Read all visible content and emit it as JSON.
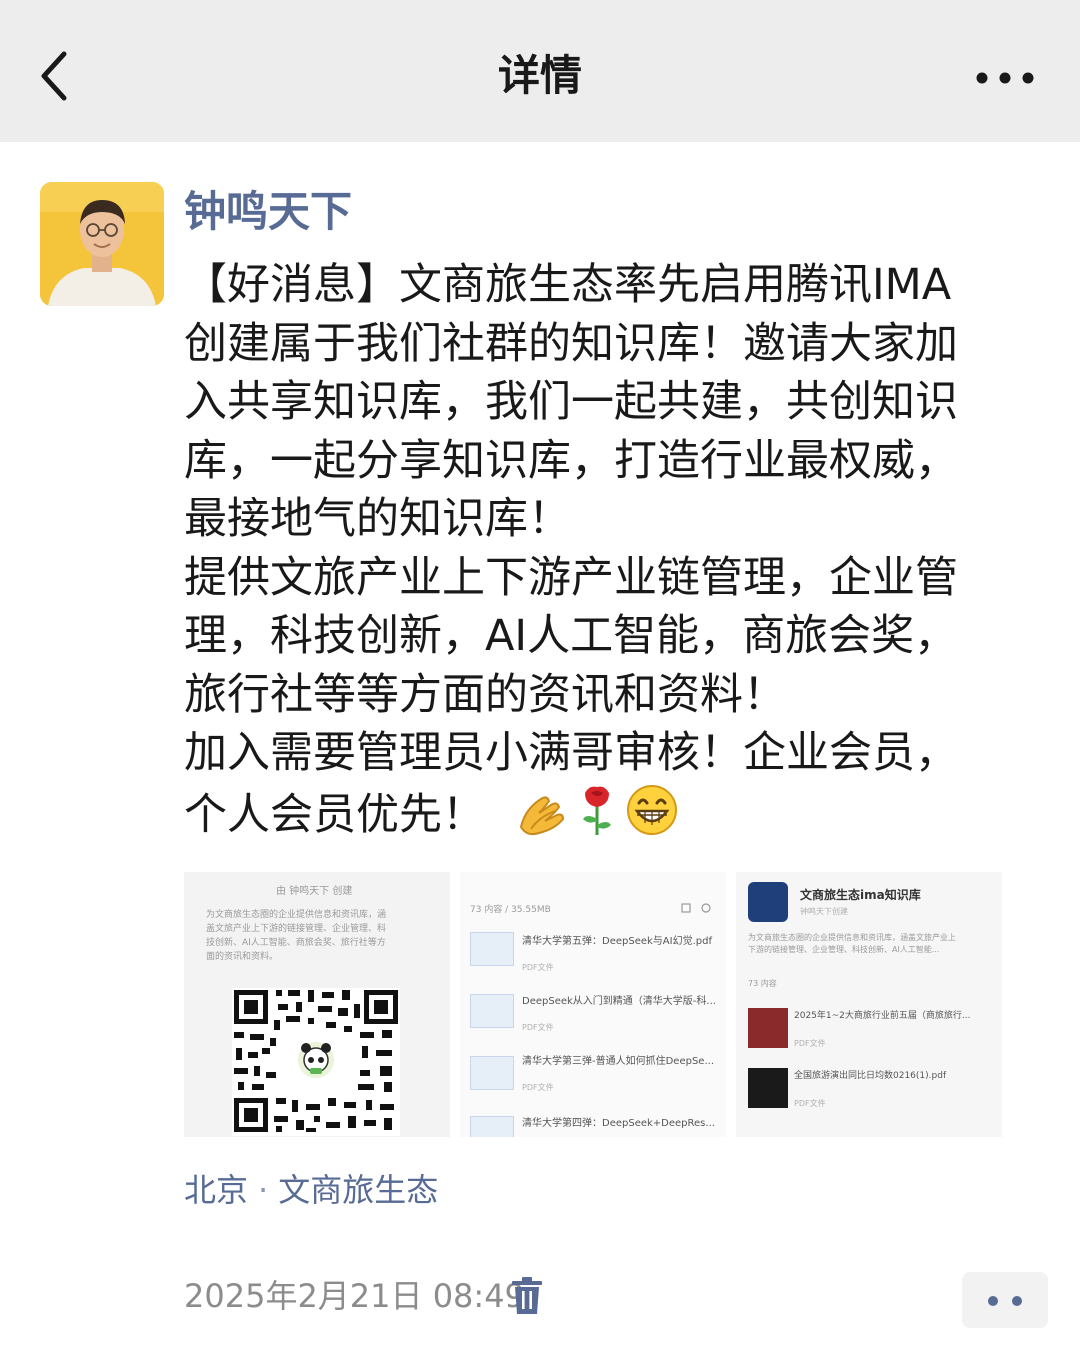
{
  "nav": {
    "title": "详情",
    "back_icon": "chevron-left-icon",
    "more_icon": "more-horizontal-icon"
  },
  "post": {
    "author": "钟鸣天下",
    "text_lines": [
      "【好消息】文商旅生态率先启用腾讯IMA",
      "创建属于我们社群的知识库！邀请大家加",
      "入共享知识库，我们一起共建，共创知识",
      "库，一起分享知识库，打造行业最权威，",
      "最接地气的知识库！",
      "提供文旅产业上下游产业链管理，企业管",
      "理，科技创新，AI人工智能，商旅会奖，",
      "旅行社等等方面的资讯和资料！",
      "加入需要管理员小满哥审核！企业会员，",
      "个人会员优先！"
    ],
    "emojis": [
      "clapping-hands-emoji",
      "rose-emoji",
      "grinning-face-emoji"
    ],
    "images": {
      "img1": {
        "header": "由 钟鸣天下 创建",
        "desc": [
          "为文商旅生态圈的企业提供信息和资讯库，涵",
          "盖文旅产业上下游的链接管理、企业管理、科",
          "技创新、AI人工智能、商旅会奖、旅行社等方",
          "面的资讯和资料。"
        ]
      },
      "img2": {
        "header": "73 内容 / 35.55MB",
        "items": [
          {
            "title": "清华大学第五弹：DeepSeek与AI幻觉.pdf",
            "meta": "PDF文件"
          },
          {
            "title": "DeepSeek从入门到精通（清华大学版-科...",
            "meta": "PDF文件"
          },
          {
            "title": "清华大学第三弹-普通人如何抓住DeepSe...",
            "meta": "PDF文件"
          },
          {
            "title": "清华大学第四弹：DeepSeek+DeepRes...",
            "meta": ""
          }
        ]
      },
      "img3": {
        "kb_title": "文商旅生态ima知识库",
        "kb_owner": "钟鸣天下创建",
        "desc": [
          "为文商旅生态圈的企业提供信息和资讯库，涵盖文旅产业上",
          "下游的链接管理、企业管理、科技创新、AI人工智能..."
        ],
        "header": "73 内容",
        "items": [
          {
            "title": "2025年1~2大商旅行业前五届（商旅旅行...",
            "meta": "PDF文件"
          },
          {
            "title": "全国旅游演出同比日均数0216(1).pdf",
            "meta": "PDF文件"
          }
        ]
      }
    },
    "location": {
      "city": "北京",
      "separator": "·",
      "place": "文商旅生态"
    },
    "timestamp": "2025年2月21日 08:49",
    "delete_icon": "trash-icon",
    "comment_icon": "more-dots-icon"
  },
  "colors": {
    "nav_bg": "#ededed",
    "link_blue": "#576b95",
    "text": "#191919",
    "muted": "#8c8c8c"
  }
}
